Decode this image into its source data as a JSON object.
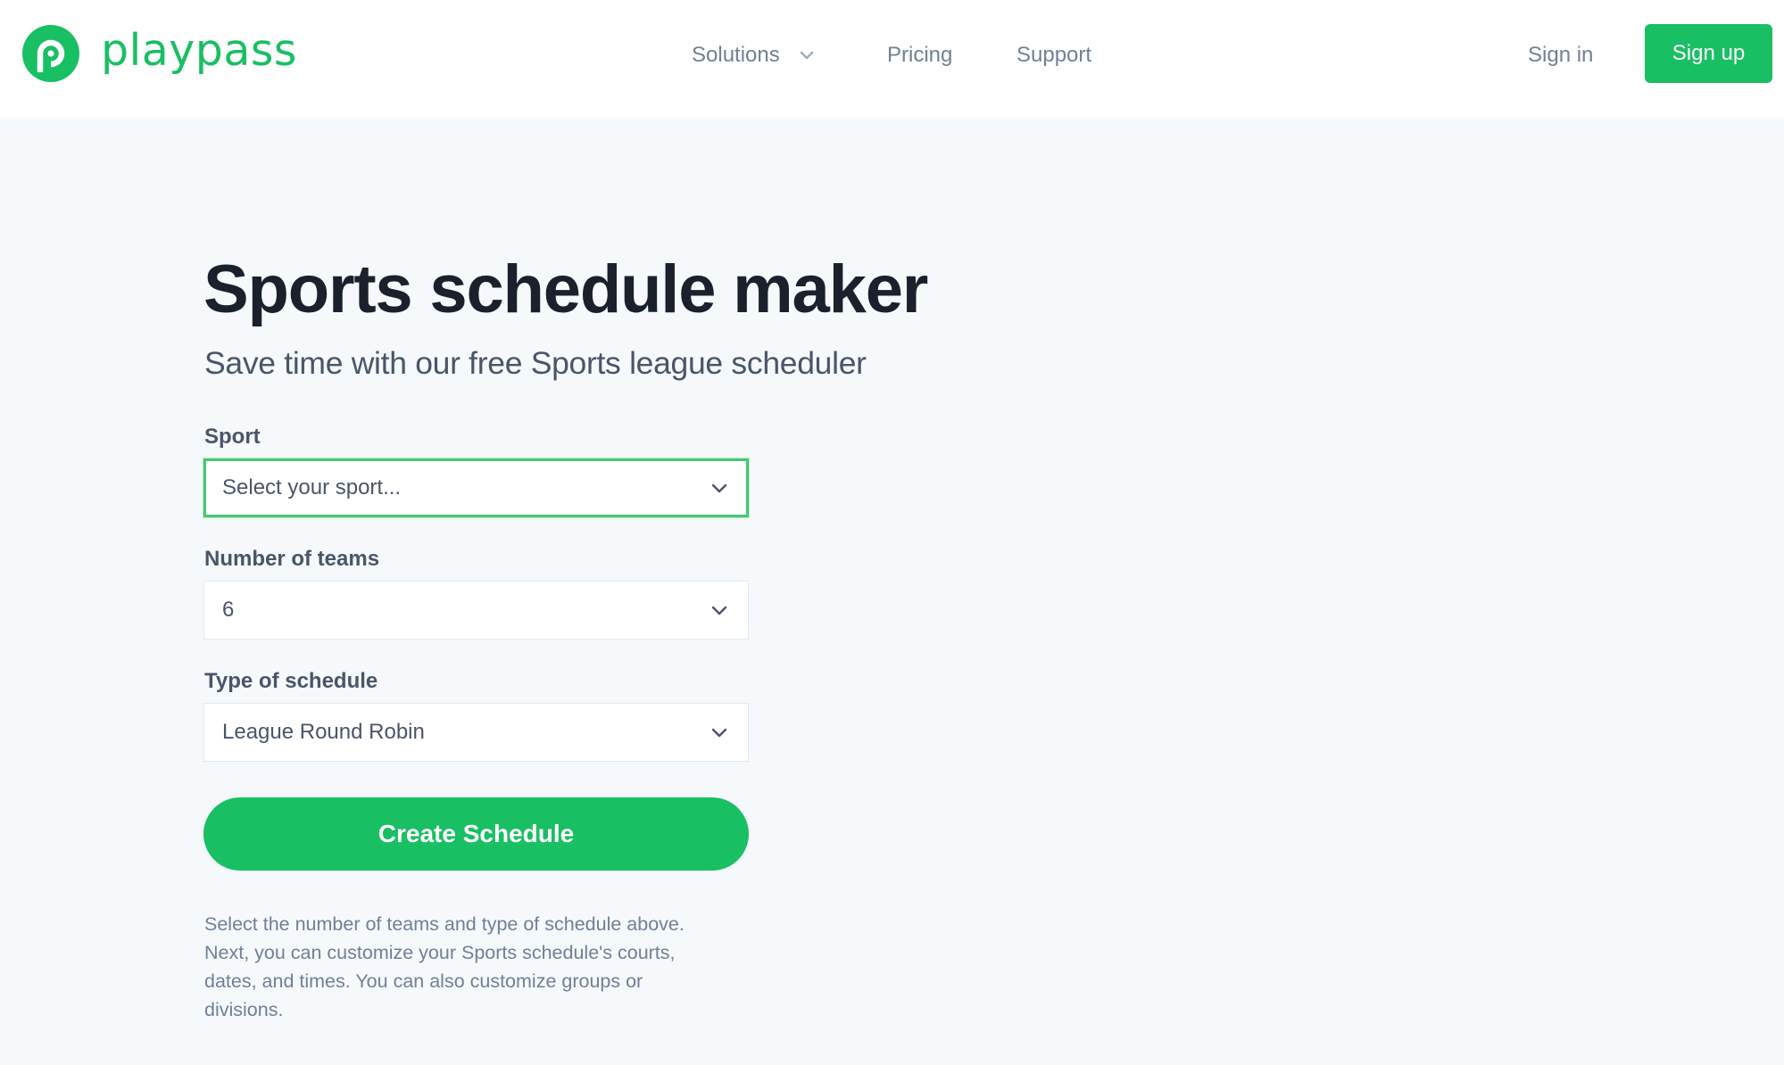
{
  "brand": {
    "name": "playpass",
    "color": "#19bf63",
    "logo_icon": "playpass-logo-icon"
  },
  "nav": {
    "items": [
      {
        "label": "Solutions",
        "has_dropdown": true,
        "icon": "chevron-down-icon"
      },
      {
        "label": "Pricing"
      },
      {
        "label": "Support"
      }
    ],
    "sign_in_label": "Sign in",
    "sign_up_label": "Sign up"
  },
  "main": {
    "title": "Sports schedule maker",
    "subtitle": "Save time with our free Sports league scheduler",
    "form": {
      "fields": [
        {
          "label": "Sport",
          "value": "",
          "placeholder": "Select your sport...",
          "display": "Select your sport...",
          "focused": true,
          "icon": "chevron-down-icon"
        },
        {
          "label": "Number of teams",
          "value": "6",
          "display": "6",
          "focused": false,
          "icon": "chevron-down-icon"
        },
        {
          "label": "Type of schedule",
          "value": "League Round Robin",
          "display": "League Round Robin",
          "focused": false,
          "icon": "chevron-down-icon"
        }
      ],
      "submit_label": "Create Schedule"
    },
    "help_text_lines": [
      "Select the number of teams and type of schedule above.",
      "Next, you can customize your Sports schedule's courts,",
      "dates, and times. You can also customize groups or",
      "divisions."
    ]
  },
  "colors": {
    "accent": "#19bf63",
    "focus_border": "#48c774",
    "page_background": "#f5f9fc",
    "heading": "#1a202c",
    "muted_text": "#718096"
  }
}
